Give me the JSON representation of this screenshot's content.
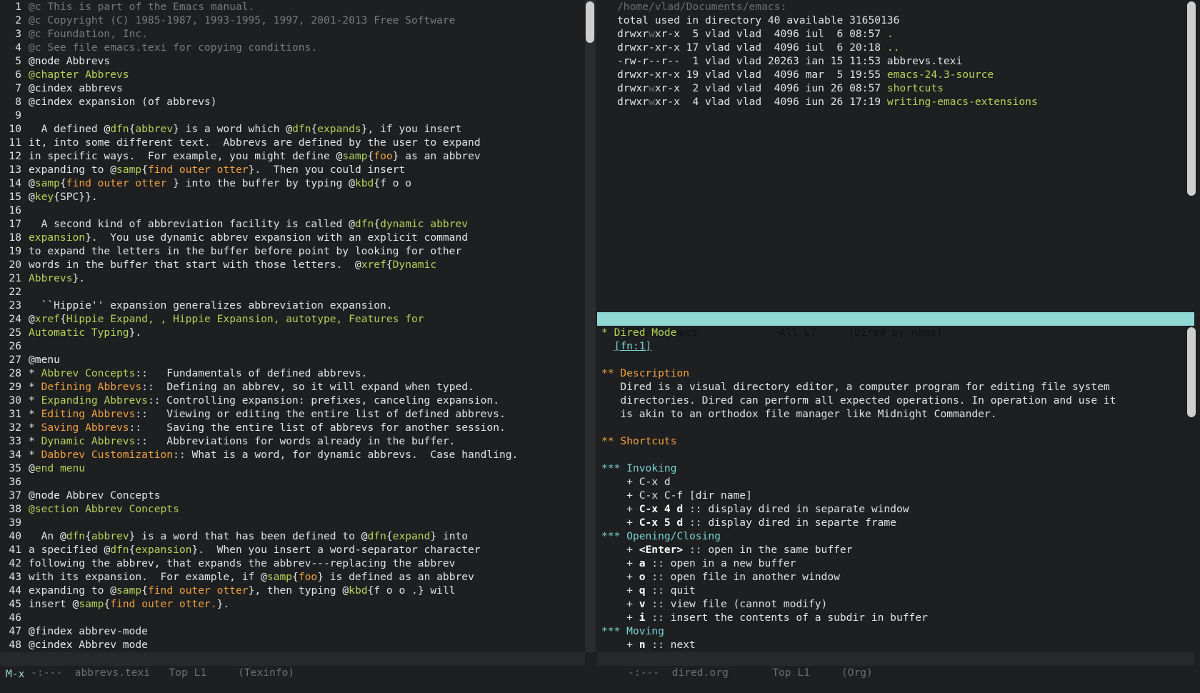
{
  "left": {
    "lines": [
      [
        [
          "c-comment",
          "@c This is part of the Emacs manual."
        ]
      ],
      [
        [
          "c-comment",
          "@c Copyright (C) 1985-1987, 1993-1995, 1997, 2001-2013 Free Software"
        ]
      ],
      [
        [
          "c-comment",
          "@c Foundation, Inc."
        ]
      ],
      [
        [
          "c-comment",
          "@c See file emacs.texi for copying conditions."
        ]
      ],
      [
        [
          "c-cmd",
          "@node "
        ],
        [
          "c-white",
          "Abbrevs"
        ]
      ],
      [
        [
          "c-green",
          "@chapter Abbrevs"
        ]
      ],
      [
        [
          "c-cmd",
          "@cindex "
        ],
        [
          "c-white",
          "abbrevs"
        ]
      ],
      [
        [
          "c-cmd",
          "@cindex "
        ],
        [
          "c-white",
          "expansion (of abbrevs)"
        ]
      ],
      [
        [
          "c-white",
          ""
        ]
      ],
      [
        [
          "c-white",
          "  A defined "
        ],
        [
          "c-cmd",
          "@"
        ],
        [
          "c-green",
          "dfn"
        ],
        [
          "c-white",
          "{"
        ],
        [
          "c-green",
          "abbrev"
        ],
        [
          "c-white",
          "} is a word which "
        ],
        [
          "c-cmd",
          "@"
        ],
        [
          "c-green",
          "dfn"
        ],
        [
          "c-white",
          "{"
        ],
        [
          "c-green",
          "expands"
        ],
        [
          "c-white",
          "}, if you insert"
        ]
      ],
      [
        [
          "c-white",
          "it, into some different text.  Abbrevs are defined by the user to expand"
        ]
      ],
      [
        [
          "c-white",
          "in specific ways.  For example, you might define "
        ],
        [
          "c-cmd",
          "@"
        ],
        [
          "c-green",
          "samp"
        ],
        [
          "c-white",
          "{"
        ],
        [
          "c-orange",
          "foo"
        ],
        [
          "c-white",
          "} as an abbrev"
        ]
      ],
      [
        [
          "c-white",
          "expanding to "
        ],
        [
          "c-cmd",
          "@"
        ],
        [
          "c-green",
          "samp"
        ],
        [
          "c-white",
          "{"
        ],
        [
          "c-orange",
          "find outer otter"
        ],
        [
          "c-white",
          "}.  Then you could insert"
        ]
      ],
      [
        [
          "c-cmd",
          "@"
        ],
        [
          "c-green",
          "samp"
        ],
        [
          "c-white",
          "{"
        ],
        [
          "c-orange",
          "find outer otter "
        ],
        [
          "c-white",
          "} into the buffer by typing "
        ],
        [
          "c-cmd",
          "@"
        ],
        [
          "c-green",
          "kbd"
        ],
        [
          "c-white",
          "{f o o"
        ]
      ],
      [
        [
          "c-cmd",
          "@"
        ],
        [
          "c-green",
          "key"
        ],
        [
          "c-white",
          "{SPC}}."
        ]
      ],
      [
        [
          "c-white",
          ""
        ]
      ],
      [
        [
          "c-white",
          "  A second kind of abbreviation facility is called "
        ],
        [
          "c-cmd",
          "@"
        ],
        [
          "c-green",
          "dfn"
        ],
        [
          "c-white",
          "{"
        ],
        [
          "c-green",
          "dynamic abbrev"
        ]
      ],
      [
        [
          "c-green",
          "expansion"
        ],
        [
          "c-white",
          "}.  You use dynamic abbrev expansion with an explicit command"
        ]
      ],
      [
        [
          "c-white",
          "to expand the letters in the buffer before point by looking for other"
        ]
      ],
      [
        [
          "c-white",
          "words in the buffer that start with those letters.  "
        ],
        [
          "c-cmd",
          "@"
        ],
        [
          "c-green",
          "xref"
        ],
        [
          "c-white",
          "{"
        ],
        [
          "c-green",
          "Dynamic"
        ]
      ],
      [
        [
          "c-green",
          "Abbrevs"
        ],
        [
          "c-white",
          "}."
        ]
      ],
      [
        [
          "c-white",
          ""
        ]
      ],
      [
        [
          "c-white",
          "  ``Hippie'' expansion generalizes abbreviation expansion."
        ]
      ],
      [
        [
          "c-cmd",
          "@"
        ],
        [
          "c-green",
          "xref"
        ],
        [
          "c-white",
          "{"
        ],
        [
          "c-green",
          "Hippie Expand, , Hippie Expansion, autotype, Features for"
        ]
      ],
      [
        [
          "c-green",
          "Automatic Typing"
        ],
        [
          "c-white",
          "}."
        ]
      ],
      [
        [
          "c-white",
          ""
        ]
      ],
      [
        [
          "c-cmd",
          "@menu"
        ]
      ],
      [
        [
          "c-white",
          "* "
        ],
        [
          "c-green",
          "Abbrev Concepts"
        ],
        [
          "c-white",
          "::   Fundamentals of defined abbrevs."
        ]
      ],
      [
        [
          "c-white",
          "* "
        ],
        [
          "c-orange",
          "Defining Abbrevs"
        ],
        [
          "c-white",
          "::  Defining an abbrev, so it will expand when typed."
        ]
      ],
      [
        [
          "c-white",
          "* "
        ],
        [
          "c-green",
          "Expanding Abbrevs"
        ],
        [
          "c-white",
          ":: Controlling expansion: prefixes, canceling expansion."
        ]
      ],
      [
        [
          "c-white",
          "* "
        ],
        [
          "c-orange",
          "Editing Abbrevs"
        ],
        [
          "c-white",
          "::   Viewing or editing the entire list of defined abbrevs."
        ]
      ],
      [
        [
          "c-white",
          "* "
        ],
        [
          "c-orange",
          "Saving Abbrevs"
        ],
        [
          "c-white",
          "::    Saving the entire list of abbrevs for another session."
        ]
      ],
      [
        [
          "c-white",
          "* "
        ],
        [
          "c-green",
          "Dynamic Abbrevs"
        ],
        [
          "c-white",
          "::   Abbreviations for words already in the buffer."
        ]
      ],
      [
        [
          "c-white",
          "* "
        ],
        [
          "c-orange",
          "Dabbrev Customization"
        ],
        [
          "c-white",
          ":: What is a word, for dynamic abbrevs.  Case handling."
        ]
      ],
      [
        [
          "c-cmd",
          "@"
        ],
        [
          "c-green",
          "end menu"
        ]
      ],
      [
        [
          "c-white",
          ""
        ]
      ],
      [
        [
          "c-cmd",
          "@node "
        ],
        [
          "c-white",
          "Abbrev Concepts"
        ]
      ],
      [
        [
          "c-green",
          "@section Abbrev Concepts"
        ]
      ],
      [
        [
          "c-white",
          ""
        ]
      ],
      [
        [
          "c-white",
          "  An "
        ],
        [
          "c-cmd",
          "@"
        ],
        [
          "c-green",
          "dfn"
        ],
        [
          "c-white",
          "{"
        ],
        [
          "c-green",
          "abbrev"
        ],
        [
          "c-white",
          "} is a word that has been defined to "
        ],
        [
          "c-cmd",
          "@"
        ],
        [
          "c-green",
          "dfn"
        ],
        [
          "c-white",
          "{"
        ],
        [
          "c-green",
          "expand"
        ],
        [
          "c-white",
          "} into"
        ]
      ],
      [
        [
          "c-white",
          "a specified "
        ],
        [
          "c-cmd",
          "@"
        ],
        [
          "c-green",
          "dfn"
        ],
        [
          "c-white",
          "{"
        ],
        [
          "c-green",
          "expansion"
        ],
        [
          "c-white",
          "}.  When you insert a word-separator character"
        ]
      ],
      [
        [
          "c-white",
          "following the abbrev, that expands the abbrev---replacing the abbrev"
        ]
      ],
      [
        [
          "c-white",
          "with its expansion.  For example, if "
        ],
        [
          "c-cmd",
          "@"
        ],
        [
          "c-green",
          "samp"
        ],
        [
          "c-white",
          "{"
        ],
        [
          "c-orange",
          "foo"
        ],
        [
          "c-white",
          "} is defined as an abbrev"
        ]
      ],
      [
        [
          "c-white",
          "expanding to "
        ],
        [
          "c-cmd",
          "@"
        ],
        [
          "c-green",
          "samp"
        ],
        [
          "c-white",
          "{"
        ],
        [
          "c-orange",
          "find outer otter"
        ],
        [
          "c-white",
          "}, then typing "
        ],
        [
          "c-cmd",
          "@"
        ],
        [
          "c-green",
          "kbd"
        ],
        [
          "c-white",
          "{f o o .} will"
        ]
      ],
      [
        [
          "c-white",
          "insert "
        ],
        [
          "c-cmd",
          "@"
        ],
        [
          "c-green",
          "samp"
        ],
        [
          "c-white",
          "{"
        ],
        [
          "c-orange",
          "find outer otter."
        ],
        [
          "c-white",
          "}."
        ]
      ],
      [
        [
          "c-white",
          ""
        ]
      ],
      [
        [
          "c-cmd",
          "@findex "
        ],
        [
          "c-white",
          "abbrev-mode"
        ]
      ],
      [
        [
          "c-cmd",
          "@cindex "
        ],
        [
          "c-white",
          "Abbrev mode"
        ]
      ]
    ],
    "modeline": "-:---  abbrevs.texi   Top L1     (Texinfo)"
  },
  "dired": {
    "lines": [
      [
        [
          "c-dim",
          "/home/vlad/Documents/emacs:"
        ]
      ],
      [
        [
          "c-white",
          "total used in directory 40 available 31650136"
        ]
      ],
      [
        [
          "c-white",
          "drwxr"
        ],
        [
          "c-dim",
          "w"
        ],
        [
          "c-white",
          "xr-x  5 vlad vlad  4096 iul  6 08:57 "
        ],
        [
          "c-green",
          "."
        ]
      ],
      [
        [
          "c-white",
          "drwxr-xr-x 17 vlad vlad  4096 iul  6 20:18 "
        ],
        [
          "c-green",
          ".."
        ]
      ],
      [
        [
          "c-white",
          "-rw-r--r--  1 vlad vlad 20263 ian 15 11:53 abbrevs.texi"
        ]
      ],
      [
        [
          "c-white",
          "drwxr-xr-x 19 vlad vlad  4096 mar  5 19:55 "
        ],
        [
          "c-green",
          "emacs-24.3-source"
        ]
      ],
      [
        [
          "c-white",
          "drwxr"
        ],
        [
          "c-dim",
          "w"
        ],
        [
          "c-white",
          "xr-x  2 vlad vlad  4096 iun 26 08:57 "
        ],
        [
          "c-green",
          "shortcuts"
        ]
      ],
      [
        [
          "c-white",
          "drwxr"
        ],
        [
          "c-dim",
          "w"
        ],
        [
          "c-white",
          "xr-x  4 vlad vlad  4096 iun 26 17:19 "
        ],
        [
          "c-green",
          "writing-emacs-extensions"
        ]
      ]
    ],
    "modeline": "U:%%-  emacs             All L7     (Dired by name)"
  },
  "org": {
    "lines": [
      [
        [
          "c-green",
          "* Dired Mode"
        ]
      ],
      [
        [
          "c-white",
          "  "
        ],
        [
          "c-cyan under",
          "[fn:1]"
        ]
      ],
      [
        [
          "c-white",
          ""
        ]
      ],
      [
        [
          "c-orange",
          "** Description"
        ]
      ],
      [
        [
          "c-white",
          "   Dired is a visual directory editor, a computer program for editing file system"
        ]
      ],
      [
        [
          "c-white",
          "   directories. Dired can perform all expected operations. In operation and use it"
        ]
      ],
      [
        [
          "c-white",
          "   is akin to an orthodox file manager like Midnight Commander."
        ]
      ],
      [
        [
          "c-white",
          ""
        ]
      ],
      [
        [
          "c-orange",
          "** Shortcuts"
        ]
      ],
      [
        [
          "c-white",
          ""
        ]
      ],
      [
        [
          "c-cyan",
          "*** Invoking"
        ]
      ],
      [
        [
          "c-white",
          "    + C-x d"
        ]
      ],
      [
        [
          "c-white",
          "    + C-x C-f [dir name]"
        ]
      ],
      [
        [
          "c-white",
          "    + "
        ],
        [
          "bold",
          "C-x 4 d"
        ],
        [
          "c-white",
          " :: display dired in separate window"
        ]
      ],
      [
        [
          "c-white",
          "    + "
        ],
        [
          "bold",
          "C-x 5 d"
        ],
        [
          "c-white",
          " :: display dired in separte frame"
        ]
      ],
      [
        [
          "c-cyan",
          "*** Opening/Closing"
        ]
      ],
      [
        [
          "c-white",
          "    + "
        ],
        [
          "bold",
          "<Enter>"
        ],
        [
          "c-white",
          " :: open in the same buffer"
        ]
      ],
      [
        [
          "c-white",
          "    + "
        ],
        [
          "bold",
          "a"
        ],
        [
          "c-white",
          " :: open in a new buffer"
        ]
      ],
      [
        [
          "c-white",
          "    + "
        ],
        [
          "bold",
          "o"
        ],
        [
          "c-white",
          " :: open file in another window"
        ]
      ],
      [
        [
          "c-white",
          "    + "
        ],
        [
          "bold",
          "q"
        ],
        [
          "c-white",
          " :: quit"
        ]
      ],
      [
        [
          "c-white",
          "    + "
        ],
        [
          "bold",
          "v"
        ],
        [
          "c-white",
          " :: view file (cannot modify)"
        ]
      ],
      [
        [
          "c-white",
          "    + "
        ],
        [
          "bold",
          "i"
        ],
        [
          "c-white",
          " :: insert the contents of a subdir in buffer"
        ]
      ],
      [
        [
          "c-cyan",
          "*** Moving"
        ]
      ],
      [
        [
          "c-white",
          "    + "
        ],
        [
          "bold",
          "n"
        ],
        [
          "c-white",
          " :: next"
        ]
      ]
    ],
    "modeline": "-:---  dired.org       Top L1     (Org)"
  },
  "minibuffer": "M-x"
}
